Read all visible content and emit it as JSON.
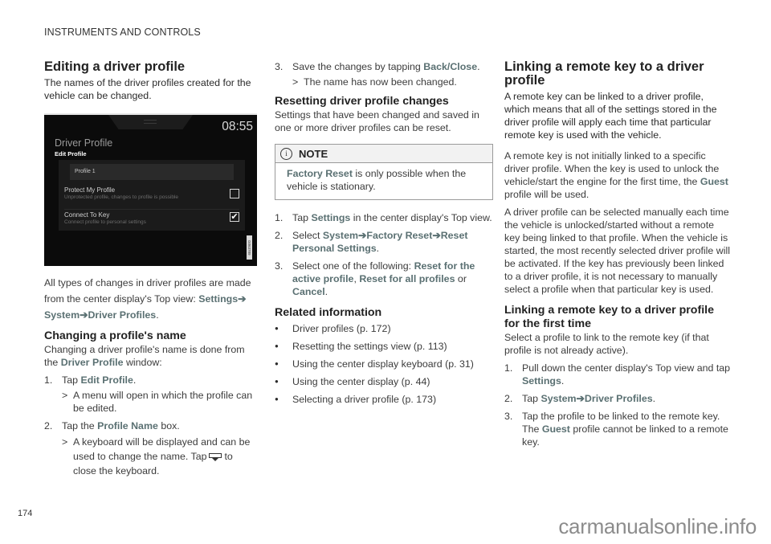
{
  "page": {
    "section_header": "INSTRUMENTS AND CONTROLS",
    "page_number": "174",
    "watermark": "carmanualsonline.info"
  },
  "editing": {
    "title": "Editing a driver profile",
    "intro": "The names of the driver profiles created for the vehicle can be changed.",
    "display": {
      "clock": "08:55",
      "title": "Driver Profile",
      "subtitle": "Edit Profile",
      "name_field_value": "Profile 1",
      "options": [
        {
          "title": "Protect My Profile",
          "subtitle": "Unprotected profile, changes to profile is possible",
          "checked": false
        },
        {
          "title": "Connect To Key",
          "subtitle": "Connect profile to personal settings",
          "checked": true
        }
      ],
      "image_code": "G063789"
    },
    "path_text": "All types of changes in driver profiles are made from the center display's Top view:",
    "path": [
      "Settings",
      "System",
      "Driver Profiles"
    ],
    "arrow_glyph": "➔"
  },
  "changing_name": {
    "title": "Changing a profile's name",
    "intro_pre": "Changing a driver profile's name is done from the",
    "intro_hl": "Driver Profile",
    "intro_post": "window:",
    "steps": [
      {
        "num": "1.",
        "pre": "Tap",
        "hl": "Edit Profile",
        "post": ".",
        "result": "A menu will open in which the profile can be edited."
      },
      {
        "num": "2.",
        "pre": "Tap the",
        "hl": "Profile Name",
        "post": "box.",
        "result_pre": "A keyboard will be displayed and can be used to change the name. Tap",
        "result_post": "to close the keyboard."
      },
      {
        "num": "3.",
        "pre": "Save the changes by tapping",
        "hl": "Back/Close",
        "post": ".",
        "result": "The name has now been changed."
      }
    ],
    "result_marker": ">"
  },
  "resetting": {
    "title": "Resetting driver profile changes",
    "intro": "Settings that have been changed and saved in one or more driver profiles can be reset.",
    "note": {
      "icon": "i",
      "title": "NOTE",
      "hl": "Factory Reset",
      "text": "is only possible when the vehicle is stationary."
    },
    "steps": [
      {
        "num": "1.",
        "pre": "Tap",
        "hl": "Settings",
        "post": "in the center display's Top view."
      },
      {
        "num": "2.",
        "pre": "Select",
        "path": [
          "System",
          "Factory Reset",
          "Reset Personal Settings"
        ],
        "post": "."
      },
      {
        "num": "3.",
        "pre": "Select one of the following:",
        "opt1": "Reset for the active profile",
        "sep": ",",
        "opt2": "Reset for all profiles",
        "or": "or",
        "opt3": "Cancel",
        "post": "."
      }
    ]
  },
  "related": {
    "title": "Related information",
    "items": [
      "Driver profiles (p. 172)",
      "Resetting the settings view (p. 113)",
      "Using the center display keyboard (p. 31)",
      "Using the center display (p. 44)",
      "Selecting a driver profile (p. 173)"
    ]
  },
  "linking": {
    "title": "Linking a remote key to a driver profile",
    "intro": "A remote key can be linked to a driver profile, which means that all of the settings stored in the driver profile will apply each time that particular remote key is used with the vehicle.",
    "para1_pre": "A remote key is not initially linked to a specific driver profile. When the key is used to unlock the vehicle/start the engine for the first time, the",
    "para1_hl": "Guest",
    "para1_post": "profile will be used.",
    "para2": "A driver profile can be selected manually each time the vehicle is unlocked/started without a remote key being linked to that profile. When the vehicle is started, the most recently selected driver profile will be activated. If the key has previ­ously been linked to a driver profile, it is not nec­essary to manually select a profile when that par­ticular key is used."
  },
  "linking_first": {
    "title": "Linking a remote key to a driver profile for the first time",
    "intro": "Select a profile to link to the remote key (if that profile is not already active).",
    "steps": [
      {
        "num": "1.",
        "pre": "Pull down the center display's Top view and tap",
        "hl": "Settings",
        "post": "."
      },
      {
        "num": "2.",
        "pre": "Tap",
        "path": [
          "System",
          "Driver Profiles"
        ],
        "post": "."
      },
      {
        "num": "3.",
        "pre": "Tap the profile to be linked to the remote key. The",
        "hl": "Guest",
        "post": "profile cannot be linked to a remote key."
      }
    ]
  }
}
